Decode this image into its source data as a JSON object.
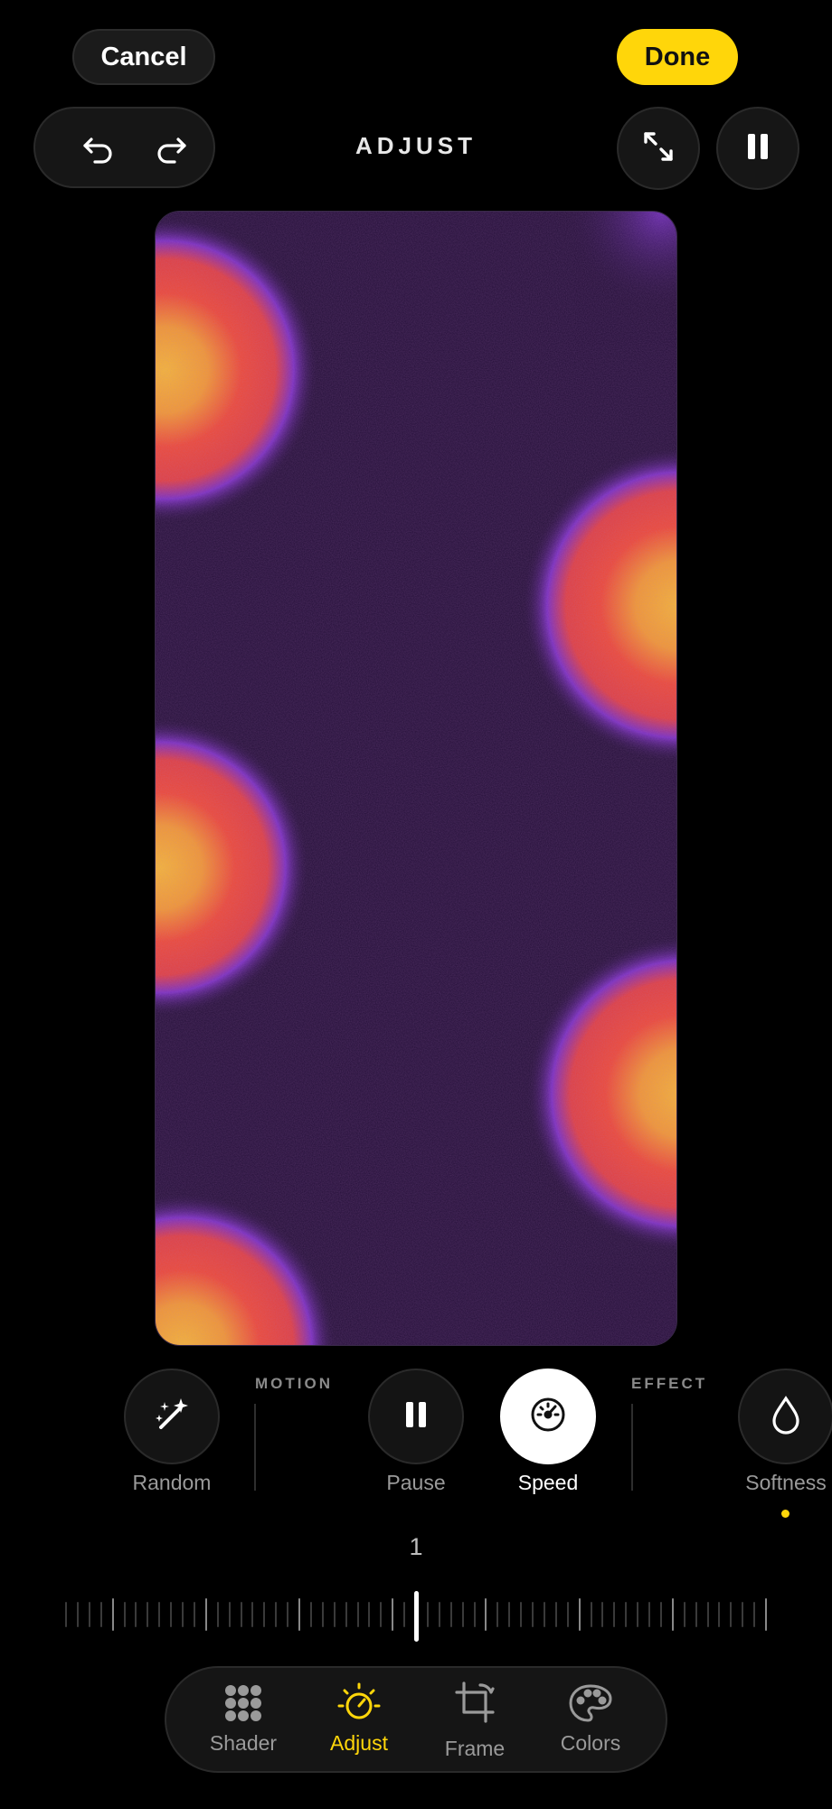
{
  "header": {
    "cancel_label": "Cancel",
    "done_label": "Done",
    "title": "ADJUST",
    "accent_color": "#ffd60a"
  },
  "toolbar_icons": [
    "undo-icon",
    "redo-icon",
    "expand-icon",
    "pause-icon"
  ],
  "controls": {
    "random_label": "Random",
    "motion_section": "MOTION",
    "pause_label": "Pause",
    "speed_label": "Speed",
    "effect_section": "EFFECT",
    "softness_label": "Softness",
    "selected": "Speed"
  },
  "slider": {
    "value": "1",
    "position_fraction": 0.5
  },
  "tabs": [
    {
      "label": "Shader",
      "icon": "grid-dots-icon"
    },
    {
      "label": "Adjust",
      "icon": "sun-dial-icon",
      "active": true
    },
    {
      "label": "Frame",
      "icon": "crop-icon"
    },
    {
      "label": "Colors",
      "icon": "palette-icon"
    }
  ],
  "preview": {
    "background_color": "#240f38",
    "blob_colors": [
      "#f7b733",
      "#ee4a35",
      "#7a2fc0"
    ]
  }
}
